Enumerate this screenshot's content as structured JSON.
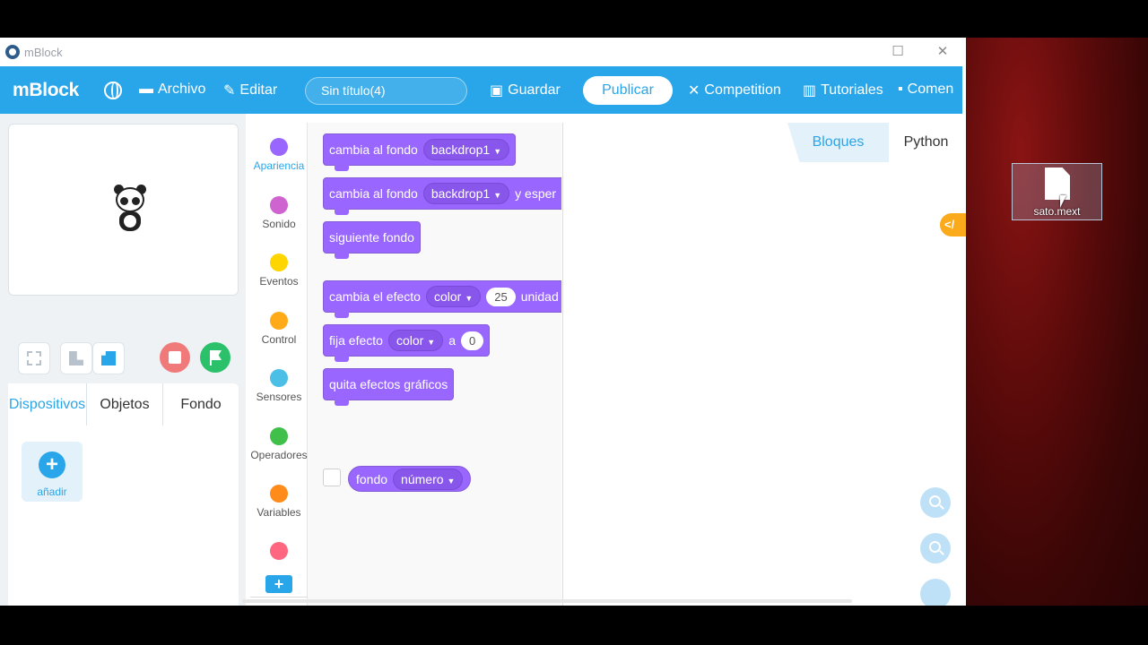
{
  "window": {
    "title": "mBlock",
    "minimize_glyph": "—",
    "maximize_glyph": "☐",
    "close_glyph": "✕"
  },
  "topbar": {
    "brand": "mBlock",
    "menu_file": "Archivo",
    "menu_edit": "Editar",
    "project_name": "Sin título(4)",
    "save": "Guardar",
    "publish": "Publicar",
    "competition": "Competition",
    "tutorials": "Tutoriales",
    "comments": "Comen"
  },
  "left_tabs": {
    "devices": "Dispositivos",
    "objects": "Objetos",
    "backdrop": "Fondo"
  },
  "add_device": {
    "plus": "+",
    "label": "añadir"
  },
  "categories": [
    {
      "label": "Apariencia",
      "color": "#9966ff"
    },
    {
      "label": "Sonido",
      "color": "#cf63cf"
    },
    {
      "label": "Eventos",
      "color": "#ffd500"
    },
    {
      "label": "Control",
      "color": "#ffab19"
    },
    {
      "label": "Sensores",
      "color": "#4cbfe6"
    },
    {
      "label": "Operadores",
      "color": "#40bf4a"
    },
    {
      "label": "Variables",
      "color": "#ff8c1a"
    },
    {
      "label": "",
      "color": "#ff6680"
    }
  ],
  "blocks": {
    "b1_text": "cambia al fondo",
    "b1_menu": "backdrop1",
    "b2_text": "cambia al fondo",
    "b2_menu": "backdrop1",
    "b2_tail": "y esper",
    "b3_text": "siguiente fondo",
    "b4_text": "cambia el efecto",
    "b4_menu": "color",
    "b4_value": "25",
    "b4_tail": "unidad",
    "b5_text": "fija efecto",
    "b5_menu": "color",
    "b5_a": "a",
    "b5_value": "0",
    "b6_text": "quita efectos gráficos",
    "r1_text": "fondo",
    "r1_menu": "número"
  },
  "code_tabs": {
    "blocks": "Bloques",
    "python": "Python"
  },
  "code_toggle": "</",
  "desktop": {
    "file_name": "sato.mext"
  }
}
